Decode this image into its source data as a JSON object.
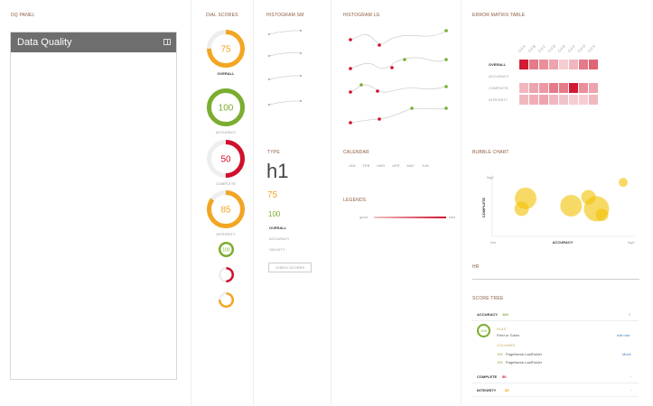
{
  "colors": {
    "good": "#7bad2f",
    "warn": "#f2a622",
    "bad": "#d0112b",
    "grey": "#6e6e6e"
  },
  "dq_panel": {
    "title": "DQ PANEL",
    "header": "Data Quality"
  },
  "dial_scores": {
    "title": "DIAL SCORES",
    "dials": [
      {
        "value": "75",
        "label": "OVERALL",
        "color": "#f2a622",
        "fraction": 0.75
      },
      {
        "value": "100",
        "label": "ACCURACY",
        "color": "#7bad2f",
        "fraction": 1.0
      },
      {
        "value": "50",
        "label": "COMPLETE",
        "color": "#d0112b",
        "fraction": 0.5
      },
      {
        "value": "85",
        "label": "INTEGRITY",
        "color": "#f2a622",
        "fraction": 0.85
      }
    ],
    "mini_dials": [
      {
        "value": "100",
        "color": "#7bad2f",
        "fraction": 1.0
      },
      {
        "value": "",
        "color": "#d0112b",
        "fraction": 0.5
      },
      {
        "value": "",
        "color": "#f2a622",
        "fraction": 0.75
      }
    ]
  },
  "histogram_sm": {
    "title": "HISTOGRAM SM"
  },
  "type_section": {
    "title": "TYPE",
    "h1": "h1",
    "num_warn": "75",
    "num_good": "100",
    "labels": [
      "OVERALL",
      "ACCURACY",
      "VALIDITY"
    ],
    "button": "CHECK SCORES"
  },
  "histogram_lg": {
    "title": "HISTOGRAM LG"
  },
  "calendar": {
    "title": "CALENDAR",
    "months": [
      "JAN",
      "FEB",
      "MAR",
      "APR",
      "MAY",
      "JUN"
    ]
  },
  "legends": {
    "title": "LEGENDS",
    "low": "good",
    "high": "bad"
  },
  "error_matrix": {
    "title": "ERROR MATRIX TABLE",
    "columns": [
      "Col A",
      "Col B",
      "Col C",
      "Col D",
      "Col E",
      "Col F",
      "Col G",
      "Col H"
    ],
    "rows": [
      {
        "label": "OVERALL",
        "cells": [
          0.95,
          0.5,
          0.4,
          0.3,
          0.1,
          0.2,
          0.5,
          0.6
        ]
      },
      {
        "label": "ACCURACY",
        "cells": [
          0,
          0,
          0,
          0,
          0,
          0,
          0,
          0
        ]
      },
      {
        "label": "COMPLETE",
        "cells": [
          0.2,
          0.3,
          0.35,
          0.5,
          0.5,
          0.95,
          0.4,
          0.3
        ]
      },
      {
        "label": "INTEGRITY",
        "cells": [
          0.2,
          0.25,
          0.3,
          0.2,
          0.15,
          0.1,
          0.1,
          0.2
        ]
      }
    ]
  },
  "chart_data": {
    "type": "scatter",
    "title": "BUBBLE CHART",
    "xlabel": "ACCURACY",
    "ylabel": "COMPLETE",
    "x_ticks": [
      "low",
      "high"
    ],
    "y_ticks": [
      "high",
      "low"
    ],
    "points": [
      {
        "x": 0.25,
        "y": 0.62,
        "r": 12
      },
      {
        "x": 0.22,
        "y": 0.45,
        "r": 8
      },
      {
        "x": 0.59,
        "y": 0.5,
        "r": 12
      },
      {
        "x": 0.72,
        "y": 0.64,
        "r": 8
      },
      {
        "x": 0.78,
        "y": 0.45,
        "r": 14
      },
      {
        "x": 0.82,
        "y": 0.35,
        "r": 7
      },
      {
        "x": 0.98,
        "y": 0.88,
        "r": 5
      }
    ]
  },
  "hr": {
    "title": "HR"
  },
  "score_tree": {
    "title": "SCORE TREE",
    "rows": [
      {
        "label": "ACCURACY",
        "value": "100",
        "color": "#7bad2f"
      },
      {
        "label": "COMPLETE",
        "value": "50",
        "color": "#d0112b"
      },
      {
        "label": "INTEGRITY",
        "value": "85",
        "color": "#f2a622"
      }
    ],
    "detail": {
      "dial": "100",
      "rule_label": "RULE",
      "rule_name": "Field or Token",
      "rule_link": "edit rule",
      "columns_label": "COLUMNS",
      "columns": [
        {
          "score": "100",
          "name": "PageName.LastFolder",
          "action": "Move"
        },
        {
          "score": "100",
          "name": "PageName.LastFolder",
          "action": ""
        }
      ]
    }
  }
}
